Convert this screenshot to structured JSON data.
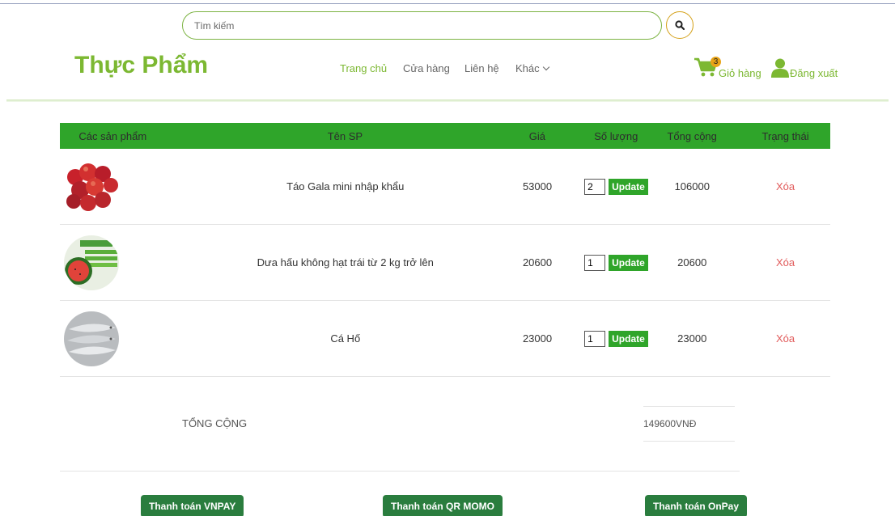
{
  "search": {
    "placeholder": "Tìm kiếm"
  },
  "header": {
    "logo": "Thực Phẩm",
    "nav": [
      "Trang chủ",
      "Cửa hàng",
      "Liên hệ",
      "Khác"
    ],
    "cart_label": "Giỏ hàng",
    "cart_count": "3",
    "logout_label": "Đăng xuất"
  },
  "table": {
    "headers": [
      "Các sản phẩm",
      "Tên SP",
      "Giá",
      "Số lượng",
      "Tổng cộng",
      "Trạng thái"
    ],
    "update_label": "Update",
    "delete_label": "Xóa",
    "rows": [
      {
        "name": "Táo Gala mini nhập khẩu",
        "price": "53000",
        "qty": "2",
        "total": "106000"
      },
      {
        "name": "Dưa hấu không hạt trái từ 2 kg trở lên",
        "price": "20600",
        "qty": "1",
        "total": "20600"
      },
      {
        "name": "Cá Hố",
        "price": "23000",
        "qty": "1",
        "total": "23000"
      }
    ]
  },
  "summary": {
    "label": "TỔNG CỘNG",
    "value": "149600VNĐ"
  },
  "payment": {
    "vnpay": "Thanh toán VNPAY",
    "momo": "Thanh toán QR MOMO",
    "onpay": "Thanh toán OnPay"
  },
  "colors": {
    "brand": "#7cb832",
    "table_header": "#2fa52a",
    "pay_button": "#2a7d3e",
    "delete": "#e15a5a"
  }
}
